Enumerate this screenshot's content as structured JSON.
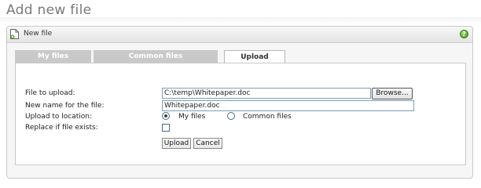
{
  "page": {
    "title": "Add new file"
  },
  "panel": {
    "header_label": "New file",
    "help_icon": "help-icon",
    "help_glyph": "?"
  },
  "tabs": [
    {
      "label": "My files",
      "active": false
    },
    {
      "label": "Common files",
      "active": false
    },
    {
      "label": "Upload",
      "active": true
    }
  ],
  "form": {
    "file_to_upload_label": "File to upload:",
    "file_path_value": "C:\\temp\\Whitepaper.doc",
    "browse_label": "Browse...",
    "new_name_label": "New name for the file:",
    "new_name_value": "Whitepaper.doc",
    "upload_location_label": "Upload to location:",
    "location_options": [
      {
        "label": "My files",
        "selected": true
      },
      {
        "label": "Common files",
        "selected": false
      }
    ],
    "replace_label": "Replace if file exists:",
    "replace_checked": false,
    "upload_button": "Upload",
    "cancel_button": "Cancel"
  },
  "colors": {
    "tab_inactive": "#c9c9c9",
    "help_green": "#4a9a1c"
  }
}
